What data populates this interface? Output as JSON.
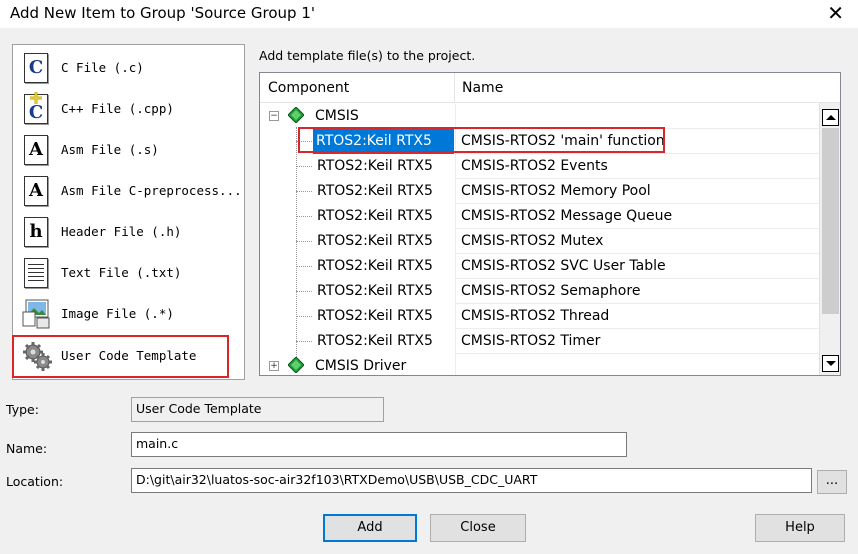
{
  "window": {
    "title": "Add New Item to Group 'Source Group 1'",
    "close_glyph": "✕"
  },
  "file_types": [
    {
      "label": "C File (.c)",
      "icon": "c-file-icon",
      "glyph": "C"
    },
    {
      "label": "C++ File (.cpp)",
      "icon": "cpp-file-icon",
      "glyph": "C"
    },
    {
      "label": "Asm File (.s)",
      "icon": "asm-file-icon",
      "glyph": "A"
    },
    {
      "label": "Asm File C-preprocess...",
      "icon": "asm-preprocess-file-icon",
      "glyph": "A"
    },
    {
      "label": "Header File (.h)",
      "icon": "header-file-icon",
      "glyph": "h"
    },
    {
      "label": "Text File (.txt)",
      "icon": "text-file-icon",
      "glyph": ""
    },
    {
      "label": "Image File (.*)",
      "icon": "image-file-icon",
      "glyph": ""
    },
    {
      "label": "User Code Template",
      "icon": "gears-icon",
      "glyph": ""
    }
  ],
  "hint": "Add template file(s) to the project.",
  "grid": {
    "headers": [
      "Component",
      "Name"
    ],
    "groups": [
      {
        "label": "CMSIS",
        "expander": "⊟"
      },
      {
        "label": "CMSIS Driver",
        "expander": "⊞"
      }
    ],
    "rows": [
      {
        "component": "RTOS2:Keil RTX5",
        "name": "CMSIS-RTOS2 'main' function"
      },
      {
        "component": "RTOS2:Keil RTX5",
        "name": "CMSIS-RTOS2 Events"
      },
      {
        "component": "RTOS2:Keil RTX5",
        "name": "CMSIS-RTOS2 Memory Pool"
      },
      {
        "component": "RTOS2:Keil RTX5",
        "name": "CMSIS-RTOS2 Message Queue"
      },
      {
        "component": "RTOS2:Keil RTX5",
        "name": "CMSIS-RTOS2 Mutex"
      },
      {
        "component": "RTOS2:Keil RTX5",
        "name": "CMSIS-RTOS2 SVC User Table"
      },
      {
        "component": "RTOS2:Keil RTX5",
        "name": "CMSIS-RTOS2 Semaphore"
      },
      {
        "component": "RTOS2:Keil RTX5",
        "name": "CMSIS-RTOS2 Thread"
      },
      {
        "component": "RTOS2:Keil RTX5",
        "name": "CMSIS-RTOS2 Timer"
      }
    ]
  },
  "form": {
    "type_label": "Type:",
    "type_value": "User Code Template",
    "name_label": "Name:",
    "name_value": "main.c",
    "location_label": "Location:",
    "location_value": "D:\\git\\air32\\luatos-soc-air32f103\\RTXDemo\\USB\\USB_CDC_UART",
    "browse_label": "..."
  },
  "buttons": {
    "add": "Add",
    "close": "Close",
    "help": "Help"
  },
  "colors": {
    "selection": "#0078d7",
    "highlight_frame": "#d9262b",
    "gem": "#1f9e3a"
  }
}
